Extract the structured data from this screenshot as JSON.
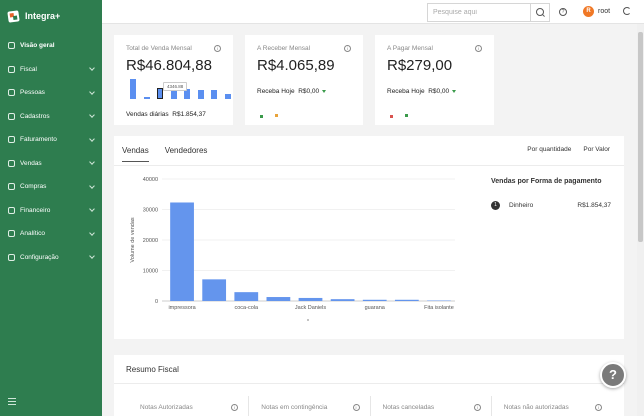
{
  "app": {
    "name": "Integra+"
  },
  "sidebar": {
    "items": [
      {
        "label": "Visão geral",
        "icon": "home-icon",
        "active": true
      },
      {
        "label": "Fiscal",
        "icon": "fiscal-icon"
      },
      {
        "label": "Pessoas",
        "icon": "people-icon"
      },
      {
        "label": "Cadastros",
        "icon": "register-icon"
      },
      {
        "label": "Faturamento",
        "icon": "billing-icon"
      },
      {
        "label": "Vendas",
        "icon": "sales-icon"
      },
      {
        "label": "Compras",
        "icon": "cart-icon"
      },
      {
        "label": "Financeiro",
        "icon": "finance-icon"
      },
      {
        "label": "Analítico",
        "icon": "analytics-icon"
      },
      {
        "label": "Configuração",
        "icon": "gear-icon"
      }
    ]
  },
  "topbar": {
    "search_placeholder": "Pesquise aqui",
    "user_initial": "R",
    "user_name": "root",
    "help_glyph": "?"
  },
  "kpis": {
    "total_vendas": {
      "title": "Total de Venda Mensal",
      "value": "R$46.804,88",
      "sub_label": "Vendas diárias",
      "sub_value": "R$1.854,37",
      "tooltip": "4346.88",
      "spark": [
        1.0,
        0.12,
        0.55,
        0.55,
        0.5,
        0.45,
        0.45,
        0.25
      ]
    },
    "a_receber": {
      "title": "A Receber Mensal",
      "value": "R$4.065,89",
      "sub_label": "Receba Hoje",
      "sub_value": "R$0,00"
    },
    "a_pagar": {
      "title": "A Pagar Mensal",
      "value": "R$279,00",
      "sub_label": "Receba Hoje",
      "sub_value": "R$0,00"
    }
  },
  "sales": {
    "tabs": [
      "Vendas",
      "Vendedores"
    ],
    "toggles": [
      "Por quantidade",
      "Por Valor"
    ],
    "payment_title": "Vendas por Forma de pagamento",
    "payments": [
      {
        "rank": "1",
        "name": "Dinheiro",
        "value": "R$1.854,37"
      }
    ]
  },
  "chart_data": {
    "type": "bar",
    "ylabel": "Volume de vendas",
    "ylim": [
      0,
      40000
    ],
    "yticks": [
      "0",
      "10000",
      "20000",
      "30000",
      "40000"
    ],
    "categories": [
      "impressora",
      "",
      "coca-cola",
      "",
      "Jack Daniels",
      "",
      "guarana",
      "",
      "Fita isolante"
    ],
    "values": [
      32300,
      7100,
      2900,
      1300,
      1000,
      600,
      400,
      400,
      150
    ],
    "color": "#6495ed",
    "grid": true
  },
  "resumo": {
    "title": "Resumo Fiscal",
    "notes": [
      "Notas Autorizadas",
      "Notas em contingência",
      "Notas canceladas",
      "Notas não autorizadas"
    ]
  },
  "colors": {
    "sidebar": "#2e7d4f",
    "accent": "#f07826",
    "bar": "#6495ed"
  }
}
